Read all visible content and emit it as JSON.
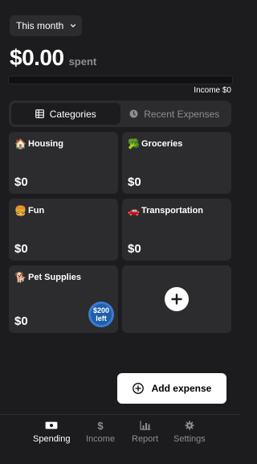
{
  "period": {
    "label": "This month"
  },
  "summary": {
    "amount": "$0.00",
    "suffix": "spent",
    "income_label": "Income $0",
    "spent_fraction": 0
  },
  "segments": [
    {
      "label": "Categories",
      "icon": "grid-icon",
      "active": true
    },
    {
      "label": "Recent Expenses",
      "icon": "clock-icon",
      "active": false
    }
  ],
  "categories": [
    {
      "emoji": "🏠",
      "name": "Housing",
      "value": "$0"
    },
    {
      "emoji": "🥦",
      "name": "Groceries",
      "value": "$0"
    },
    {
      "emoji": "🍔",
      "name": "Fun",
      "value": "$0"
    },
    {
      "emoji": "🚗",
      "name": "Transportation",
      "value": "$0"
    },
    {
      "emoji": "🐕",
      "name": "Pet Supplies",
      "value": "$0",
      "badge_line1": "$200",
      "badge_line2": "left"
    }
  ],
  "add_category_icon": "plus-icon",
  "add_expense": {
    "label": "Add expense",
    "icon": "plus-circle-icon"
  },
  "tabs": [
    {
      "label": "Spending",
      "icon": "money-icon",
      "active": true
    },
    {
      "label": "Income",
      "icon": "dollar-icon",
      "active": false
    },
    {
      "label": "Report",
      "icon": "bar-chart-icon",
      "active": false
    },
    {
      "label": "Settings",
      "icon": "gear-icon",
      "active": false
    }
  ],
  "colors": {
    "background": "#1c1c1e",
    "card": "#2c2c2e",
    "badge": "#1f5faa",
    "muted": "#8e8e93"
  }
}
